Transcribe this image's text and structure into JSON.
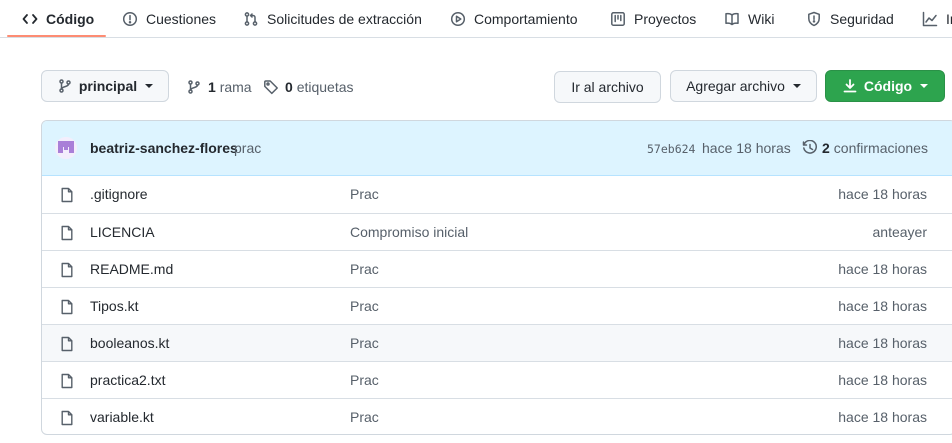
{
  "repo_nav": {
    "tabs": [
      {
        "label": "Código",
        "icon": "code-icon",
        "active": true
      },
      {
        "label": "Cuestiones",
        "icon": "issue-icon"
      },
      {
        "label": "Solicitudes de extracción",
        "icon": "pull-request-icon"
      },
      {
        "label": "Comportamiento",
        "icon": "actions-play-icon"
      },
      {
        "label": "Proyectos",
        "icon": "project-board-icon"
      },
      {
        "label": "Wiki",
        "icon": "book-icon"
      },
      {
        "label": "Seguridad",
        "icon": "shield-icon"
      },
      {
        "label": "In",
        "icon": "graph-icon"
      }
    ],
    "active_color": "#fd8c73"
  },
  "toolbar": {
    "branch_button_label": "principal",
    "branches_count": "1",
    "branches_label": "rama",
    "tags_count": "0",
    "tags_label": "etiquetas",
    "goto_file_label": "Ir al archivo",
    "add_file_label": "Agregar archivo",
    "code_label": "Código",
    "code_button_color": "#2da44e"
  },
  "latest_commit": {
    "author": "beatriz-sanchez-flores",
    "message": "prac",
    "sha": "57eb624",
    "time": "hace 18 horas",
    "commits_count": "2",
    "commits_label": "confirmaciones",
    "header_color": "#ddf4ff"
  },
  "files": [
    {
      "name": ".gitignore",
      "message": "Prac",
      "age": "hace 18 horas"
    },
    {
      "name": "LICENCIA",
      "message": "Compromiso inicial",
      "age": "anteayer"
    },
    {
      "name": "README.md",
      "message": "Prac",
      "age": "hace 18 horas"
    },
    {
      "name": "Tipos.kt",
      "message": "Prac",
      "age": "hace 18 horas"
    },
    {
      "name": "booleanos.kt",
      "message": "Prac",
      "age": "hace 18 horas",
      "highlighted": true
    },
    {
      "name": "practica2.txt",
      "message": "Prac",
      "age": "hace 18 horas"
    },
    {
      "name": "variable.kt",
      "message": "Prac",
      "age": "hace 18 horas"
    }
  ]
}
